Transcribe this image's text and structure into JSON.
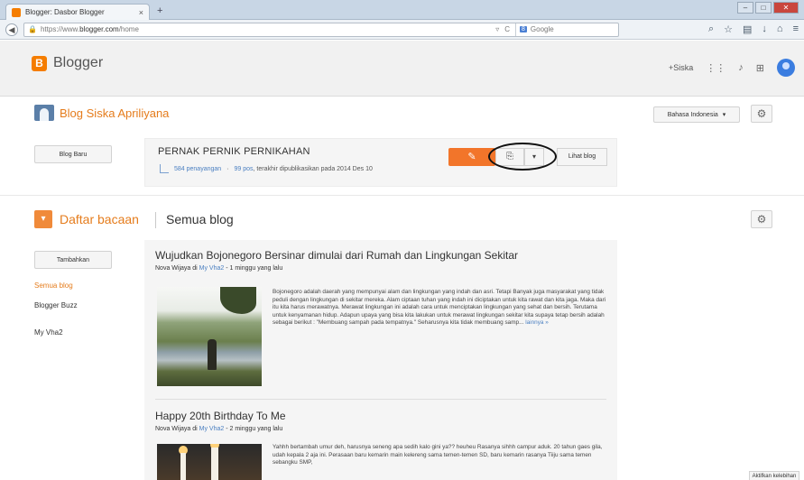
{
  "browser": {
    "tab_title": "Blogger: Dasbor Blogger",
    "tab_close": "×",
    "new_tab": "+",
    "url_protocol": "https://www.",
    "url_domain": "blogger.com",
    "url_path": "/home",
    "search_placeholder": "Google"
  },
  "header": {
    "logo_letter": "B",
    "brand": "Blogger",
    "user": "+Siska"
  },
  "blog": {
    "title": "Blog Siska Apriliyana",
    "language": "Bahasa Indonesia",
    "new_blog_label": "Blog Baru",
    "name": "PERNAK PERNIK PERNIKAHAN",
    "views": "584 penayangan",
    "posts": "99 pos",
    "published_text": ", terakhir dipublikasikan pada 2014 Des 10",
    "view_blog_label": "Lihat blog"
  },
  "reading_list": {
    "title": "Daftar bacaan",
    "filter": "Semua blog",
    "add_label": "Tambahkan",
    "nav": [
      {
        "label": "Semua blog",
        "active": true
      },
      {
        "label": "Blogger Buzz",
        "active": false
      },
      {
        "label": "My Vha2",
        "active": false
      }
    ]
  },
  "posts": [
    {
      "title": "Wujudkan Bojonegoro Bersinar dimulai dari Rumah dan Lingkungan Sekitar",
      "author": "Nova Wijaya",
      "di": " di ",
      "blog": "My Vha2",
      "ago": " - 1 minggu yang lalu",
      "excerpt": "Bojonegoro adalah daerah yang mempunyai alam dan lingkungan yang indah dan asri. Tetapi Banyak juga masyarakat yang tidak peduli dengan lingkungan di sekitar mereka. Alam ciptaan tuhan yang indah ini diciptakan untuk kita rawat dan kita jaga. Maka dari itu kita harus merawatnya. Merawat lingkungan ini adalah cara untuk menciptakan lingkungan yang sehat dan bersih. Terutama untuk kenyamanan hidup. Adapun upaya yang bisa kita lakukan untuk merawat lingkungan sekitar kita supaya tetap bersih adalah sebagai berikut : \"Membuang sampah pada tempatnya.\" Seharusnya kita tidak membuang samp... ",
      "more": "lainnya »"
    },
    {
      "title": "Happy 20th Birthday To Me",
      "author": "Nova Wijaya",
      "di": " di ",
      "blog": "My Vha2",
      "ago": " - 2 minggu yang lalu",
      "excerpt": "Yahhh bertambah umur deh, harusnya seneng apa sedih kalo gini ya?? heuheu Rasanya sihhh campur aduk. 20 tahun gaes gila, udah kepala 2 aja ini. Perasaan baru kemarin main kelereng sama temen-temen SD, baru kemarin rasanya Tiiju sama temen sebangku SMP,",
      "more": ""
    }
  ],
  "footer": {
    "hide_label": "Aktifkan kelebihan"
  },
  "icons": {
    "back": "back-arrow-icon",
    "lock": "lock-icon",
    "edit": "pencil-icon",
    "copy": "copy-icon",
    "gear": "gear-icon",
    "apps": "apps-grid-icon",
    "bell": "bell-icon",
    "share": "share-icon"
  },
  "colors": {
    "accent": "#f57d00",
    "link": "#4a7fc1"
  }
}
